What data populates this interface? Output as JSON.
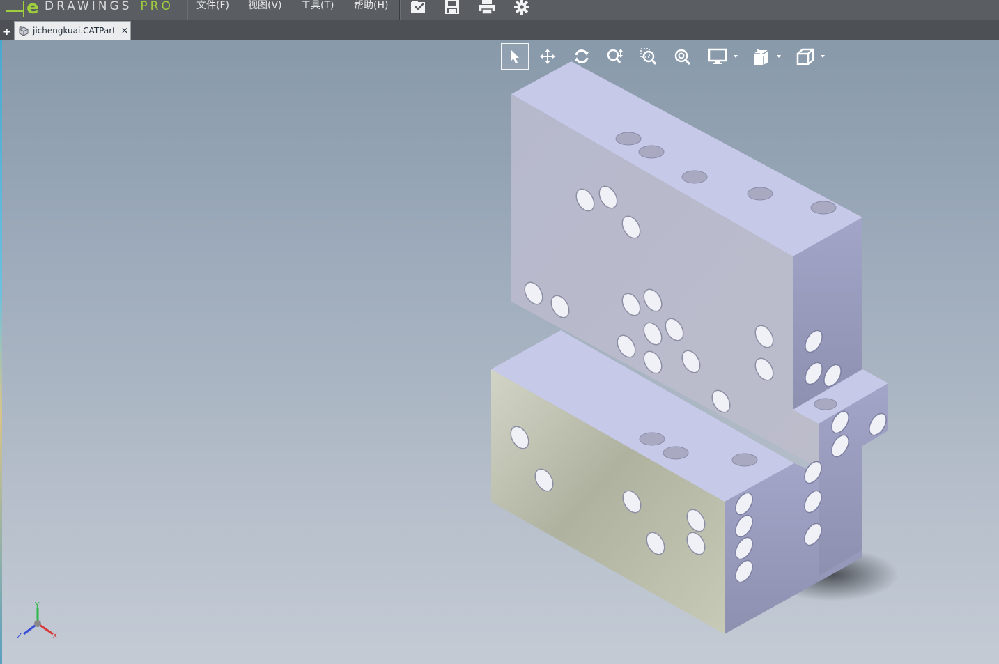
{
  "app": {
    "logo_text": "DRAWINGS",
    "logo_pro": "PRO",
    "menu": [
      {
        "label": "文件(F)"
      },
      {
        "label": "视图(V)"
      },
      {
        "label": "工具(T)"
      },
      {
        "label": "帮助(H)"
      }
    ]
  },
  "toolbar": {
    "icons": [
      "open-file-icon",
      "save-icon",
      "print-icon",
      "settings-gear-icon"
    ]
  },
  "tabs": {
    "add_label": "+",
    "items": [
      {
        "label": "jichengkuai.CATPart",
        "close": "✕"
      }
    ]
  },
  "view_tools": {
    "icons": [
      "select-arrow-icon",
      "pan-icon",
      "rotate-icon",
      "zoom-icon",
      "zoom-window-icon",
      "zoom-fit-icon",
      "display-style-icon",
      "section-view-icon",
      "standard-views-icon"
    ]
  },
  "triad": {
    "x_label": "X",
    "y_label": "Y",
    "z_label": "Z"
  },
  "colors": {
    "face_top": "#c6c9e8",
    "face_front": "#b8bac8",
    "face_right": "#9c9fc2",
    "face_lower_front": "#c8cab8",
    "accent_green": "#9fcf3c"
  }
}
